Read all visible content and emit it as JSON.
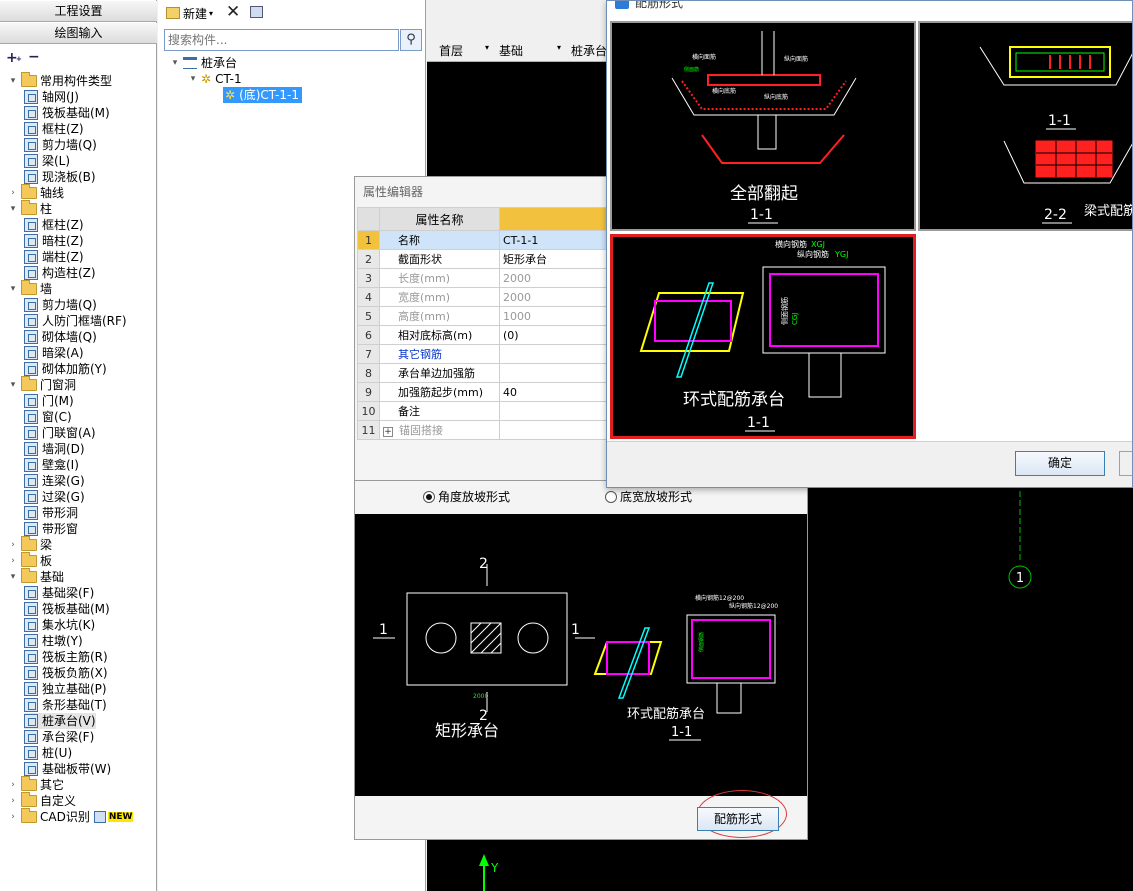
{
  "left_panel": {
    "tab_project": "工程设置",
    "tab_drawing": "绘图输入",
    "tree": [
      {
        "label": "常用构件类型",
        "type": "folder",
        "level": 0,
        "expanded": true
      },
      {
        "label": "轴网(J)",
        "type": "item",
        "level": 1
      },
      {
        "label": "筏板基础(M)",
        "type": "item",
        "level": 1
      },
      {
        "label": "框柱(Z)",
        "type": "item",
        "level": 1
      },
      {
        "label": "剪力墙(Q)",
        "type": "item",
        "level": 1
      },
      {
        "label": "梁(L)",
        "type": "item",
        "level": 1
      },
      {
        "label": "现浇板(B)",
        "type": "item",
        "level": 1
      },
      {
        "label": "轴线",
        "type": "folder",
        "level": 0,
        "expanded": false
      },
      {
        "label": "柱",
        "type": "folder",
        "level": 0,
        "expanded": true
      },
      {
        "label": "框柱(Z)",
        "type": "item",
        "level": 1
      },
      {
        "label": "暗柱(Z)",
        "type": "item",
        "level": 1
      },
      {
        "label": "端柱(Z)",
        "type": "item",
        "level": 1
      },
      {
        "label": "构造柱(Z)",
        "type": "item",
        "level": 1
      },
      {
        "label": "墙",
        "type": "folder",
        "level": 0,
        "expanded": true
      },
      {
        "label": "剪力墙(Q)",
        "type": "item",
        "level": 1
      },
      {
        "label": "人防门框墙(RF)",
        "type": "item",
        "level": 1
      },
      {
        "label": "砌体墙(Q)",
        "type": "item",
        "level": 1
      },
      {
        "label": "暗梁(A)",
        "type": "item",
        "level": 1
      },
      {
        "label": "砌体加筋(Y)",
        "type": "item",
        "level": 1
      },
      {
        "label": "门窗洞",
        "type": "folder",
        "level": 0,
        "expanded": true
      },
      {
        "label": "门(M)",
        "type": "item",
        "level": 1
      },
      {
        "label": "窗(C)",
        "type": "item",
        "level": 1
      },
      {
        "label": "门联窗(A)",
        "type": "item",
        "level": 1
      },
      {
        "label": "墙洞(D)",
        "type": "item",
        "level": 1
      },
      {
        "label": "壁龛(I)",
        "type": "item",
        "level": 1
      },
      {
        "label": "连梁(G)",
        "type": "item",
        "level": 1
      },
      {
        "label": "过梁(G)",
        "type": "item",
        "level": 1
      },
      {
        "label": "带形洞",
        "type": "item",
        "level": 1
      },
      {
        "label": "带形窗",
        "type": "item",
        "level": 1
      },
      {
        "label": "梁",
        "type": "folder",
        "level": 0,
        "expanded": false
      },
      {
        "label": "板",
        "type": "folder",
        "level": 0,
        "expanded": false
      },
      {
        "label": "基础",
        "type": "folder",
        "level": 0,
        "expanded": true
      },
      {
        "label": "基础梁(F)",
        "type": "item",
        "level": 1
      },
      {
        "label": "筏板基础(M)",
        "type": "item",
        "level": 1
      },
      {
        "label": "集水坑(K)",
        "type": "item",
        "level": 1
      },
      {
        "label": "柱墩(Y)",
        "type": "item",
        "level": 1
      },
      {
        "label": "筏板主筋(R)",
        "type": "item",
        "level": 1
      },
      {
        "label": "筏板负筋(X)",
        "type": "item",
        "level": 1
      },
      {
        "label": "独立基础(P)",
        "type": "item",
        "level": 1
      },
      {
        "label": "条形基础(T)",
        "type": "item",
        "level": 1
      },
      {
        "label": "桩承台(V)",
        "type": "item",
        "level": 1,
        "selected": true
      },
      {
        "label": "承台梁(F)",
        "type": "item",
        "level": 1
      },
      {
        "label": "桩(U)",
        "type": "item",
        "level": 1
      },
      {
        "label": "基础板带(W)",
        "type": "item",
        "level": 1
      },
      {
        "label": "其它",
        "type": "folder",
        "level": 0,
        "expanded": false
      },
      {
        "label": "自定义",
        "type": "folder",
        "level": 0,
        "expanded": false
      },
      {
        "label": "CAD识别",
        "type": "folder",
        "level": 0,
        "expanded": false,
        "badge": "NEW"
      }
    ]
  },
  "mid_panel": {
    "new_label": "新建",
    "search_placeholder": "搜索构件...",
    "tree_root": "桩承台",
    "tree_child": "CT-1",
    "tree_leaf": "(底)CT-1-1"
  },
  "canvas_toolbar": {
    "floor": "首层",
    "category": "基础",
    "type": "桩承台"
  },
  "canvas": {
    "axis_label": "1",
    "y_label": "Y"
  },
  "prop_editor": {
    "title": "属性编辑器",
    "header_name": "属性名称",
    "rows": [
      {
        "no": "1",
        "name": "名称",
        "value": "CT-1-1",
        "style": "selected"
      },
      {
        "no": "2",
        "name": "截面形状",
        "value": "矩形承台",
        "style": ""
      },
      {
        "no": "3",
        "name": "长度(mm)",
        "value": "2000",
        "style": "dim"
      },
      {
        "no": "4",
        "name": "宽度(mm)",
        "value": "2000",
        "style": "dim"
      },
      {
        "no": "5",
        "name": "高度(mm)",
        "value": "1000",
        "style": "dim"
      },
      {
        "no": "6",
        "name": "相对底标高(m)",
        "value": "(0)",
        "style": ""
      },
      {
        "no": "7",
        "name": "其它钢筋",
        "value": "",
        "style": "link"
      },
      {
        "no": "8",
        "name": "承台单边加强筋",
        "value": "",
        "style": ""
      },
      {
        "no": "9",
        "name": "加强筋起步(mm)",
        "value": "40",
        "style": ""
      },
      {
        "no": "10",
        "name": "备注",
        "value": "",
        "style": ""
      },
      {
        "no": "11",
        "name": "锚固搭接",
        "value": "",
        "style": "dim",
        "expand": true
      }
    ]
  },
  "preview": {
    "radio_angle": "角度放坡形式",
    "radio_width": "底宽放坡形式",
    "rect_caption": "矩形承台",
    "section_2": "2",
    "section_1": "1",
    "dim_2000": "2000",
    "ring_caption": "环式配筋承台",
    "ring_section": "1-1",
    "horiz_rebar": "横向钢筋12@200",
    "long_rebar": "纵向钢筋12@200",
    "side_rebar": "侧面钢筋",
    "button": "配筋形式"
  },
  "rebar_dialog": {
    "title": "配筋形式",
    "option1_caption": "全部翻起",
    "option1_section": "1-1",
    "option1_labels": [
      "横向面筋",
      "纵向面筋",
      "横向底筋",
      "纵向底筋",
      "侧面筋"
    ],
    "option2_section1": "1-1",
    "option2_section2": "2-2",
    "option2_caption": "梁式配筋",
    "option3_caption": "环式配筋承台",
    "option3_section": "1-1",
    "option3_label1": "横向钢筋",
    "option3_label2": "纵向钢筋",
    "option3_code1": "XGJ",
    "option3_code2": "YGJ",
    "option3_side": "侧面钢筋",
    "option3_code3": "CGJ",
    "ok": "确定"
  },
  "colors": {
    "accent_blue": "#3399ff",
    "header_gold": "#f2c23e",
    "highlight_red": "#e02020",
    "cad_magenta": "#ff00ff",
    "cad_yellow": "#ffff00",
    "cad_cyan": "#00ffff",
    "cad_green": "#00ff00",
    "cad_red": "#ff2020"
  }
}
